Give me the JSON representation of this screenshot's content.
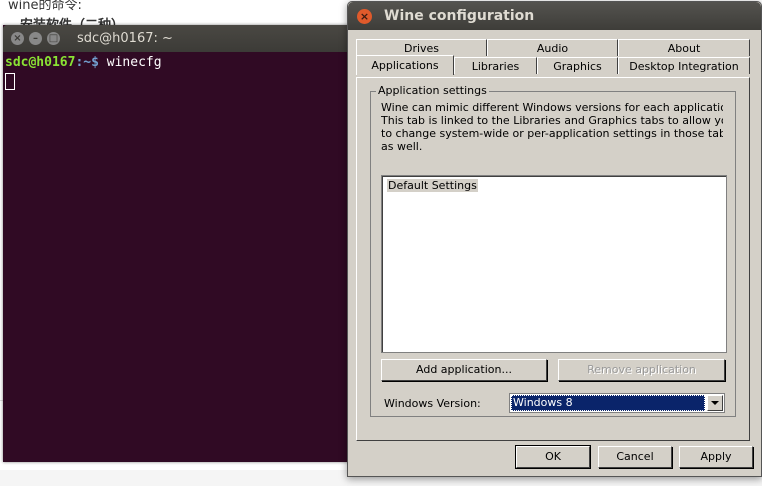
{
  "background": {
    "line1": "wine的命令:",
    "line2": "安装软件（二种）"
  },
  "terminal": {
    "title": "sdc@h0167: ~",
    "prompt_user": "sdc@h0167",
    "prompt_path": ":~$",
    "command": " winecfg"
  },
  "dialog": {
    "title": "Wine configuration",
    "tabs_row1": [
      "Drives",
      "Audio",
      "About"
    ],
    "tabs_row2": [
      "Applications",
      "Libraries",
      "Graphics",
      "Desktop Integration"
    ],
    "active_tab": "Applications",
    "group_label": "Application settings",
    "description": [
      "Wine can mimic different Windows versions for each applicatio",
      "This tab is linked to the Libraries and Graphics tabs to allow yo",
      "to change system-wide or per-application settings in those tabs",
      "as well."
    ],
    "list_items": [
      "Default Settings"
    ],
    "add_button": "Add application...",
    "remove_button": "Remove application",
    "windows_version_label": "Windows Version:",
    "windows_version_value": "Windows 8",
    "ok": "OK",
    "cancel": "Cancel",
    "apply": "Apply"
  },
  "colors": {
    "terminal_bg": "#300a24",
    "dialog_bg": "#d4d0c8",
    "selection": "#0a246a",
    "close_button": "#e05a2b"
  }
}
